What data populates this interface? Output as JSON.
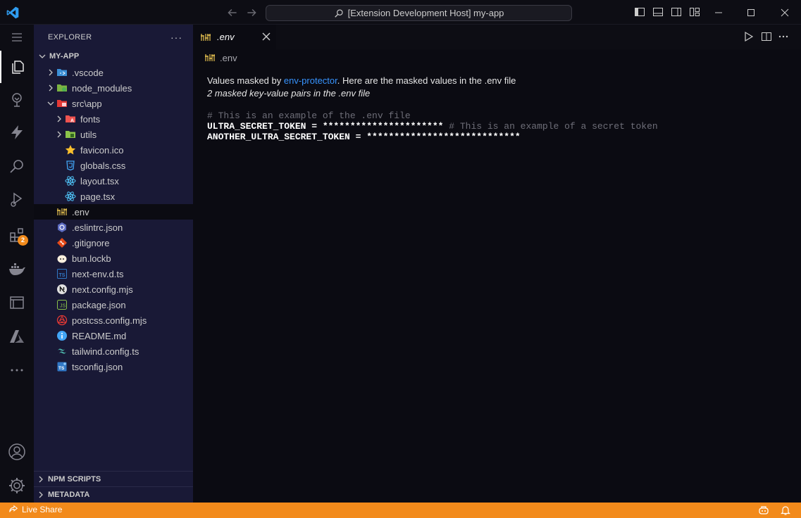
{
  "titlebar": {
    "command_center": "[Extension Development Host] my-app"
  },
  "sidebar": {
    "title": "EXPLORER",
    "project": "MY-APP",
    "tree": [
      {
        "label": ".vscode",
        "type": "folder",
        "icon": "vscode-folder-icon",
        "depth": 1,
        "expanded": false
      },
      {
        "label": "node_modules",
        "type": "folder",
        "icon": "node-folder-icon",
        "depth": 1,
        "expanded": false
      },
      {
        "label": "src\\app",
        "type": "folder",
        "icon": "app-folder-icon",
        "depth": 1,
        "expanded": true
      },
      {
        "label": "fonts",
        "type": "folder",
        "icon": "fonts-folder-icon",
        "depth": 2,
        "expanded": false
      },
      {
        "label": "utils",
        "type": "folder",
        "icon": "utils-folder-icon",
        "depth": 2,
        "expanded": false
      },
      {
        "label": "favicon.ico",
        "type": "file",
        "icon": "star-icon",
        "depth": 2
      },
      {
        "label": "globals.css",
        "type": "file",
        "icon": "css-icon",
        "depth": 2
      },
      {
        "label": "layout.tsx",
        "type": "file",
        "icon": "react-icon",
        "depth": 2
      },
      {
        "label": "page.tsx",
        "type": "file",
        "icon": "react-icon",
        "depth": 2
      },
      {
        "label": ".env",
        "type": "file",
        "icon": "env-icon",
        "depth": 1,
        "selected": true
      },
      {
        "label": ".eslintrc.json",
        "type": "file",
        "icon": "eslint-icon",
        "depth": 1
      },
      {
        "label": ".gitignore",
        "type": "file",
        "icon": "git-icon",
        "depth": 1
      },
      {
        "label": "bun.lockb",
        "type": "file",
        "icon": "bun-icon",
        "depth": 1
      },
      {
        "label": "next-env.d.ts",
        "type": "file",
        "icon": "ts-icon",
        "depth": 1
      },
      {
        "label": "next.config.mjs",
        "type": "file",
        "icon": "next-icon",
        "depth": 1
      },
      {
        "label": "package.json",
        "type": "file",
        "icon": "npm-icon",
        "depth": 1
      },
      {
        "label": "postcss.config.mjs",
        "type": "file",
        "icon": "postcss-icon",
        "depth": 1
      },
      {
        "label": "README.md",
        "type": "file",
        "icon": "info-icon",
        "depth": 1
      },
      {
        "label": "tailwind.config.ts",
        "type": "file",
        "icon": "tailwind-icon",
        "depth": 1
      },
      {
        "label": "tsconfig.json",
        "type": "file",
        "icon": "tsconfig-icon",
        "depth": 1
      }
    ],
    "sections": [
      "NPM SCRIPTS",
      "METADATA"
    ]
  },
  "activitybar": {
    "extensions_badge": "2"
  },
  "editor": {
    "tab_label": ".env",
    "breadcrumb": ".env",
    "preview": {
      "intro_before": "Values masked by ",
      "link": "env-protector",
      "intro_after": ". Here are the masked values in the .env file",
      "subtitle": "2 masked key-value pairs in the .env file",
      "code_comment": "# This is an example of the .env file",
      "lines": [
        {
          "text": "ULTRA_SECRET_TOKEN = ********************** ",
          "comment": "# This is an example of a secret token"
        },
        {
          "text": "ANOTHER_ULTRA_SECRET_TOKEN = ****************************",
          "comment": ""
        }
      ]
    }
  },
  "statusbar": {
    "live_share": "Live Share"
  },
  "colors": {
    "accent": "#f28a1b",
    "sidebar_bg": "#191936",
    "editor_bg": "#0b0b12",
    "link": "#3794ff"
  }
}
